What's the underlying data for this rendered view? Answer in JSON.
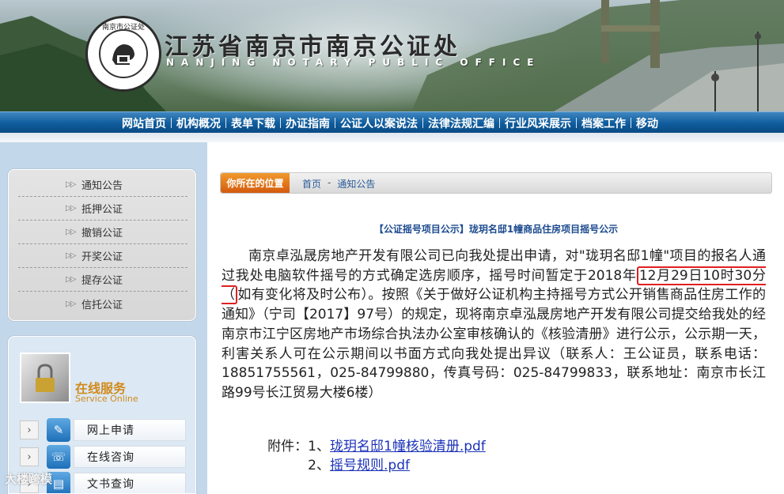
{
  "header": {
    "logo_text": "南京市公证处",
    "logo_ring_text": "NANJING NOTARY PUBLIC OFFICE",
    "title": "江苏省南京市南京公证处",
    "subtitle": "NANJING NOTARY PUBLIC OFFICE"
  },
  "nav": {
    "items": [
      "网站首页",
      "机构概况",
      "表单下载",
      "办证指南",
      "公证人以案说法",
      "法律法规汇编",
      "行业风采展示",
      "档案工作",
      "移动"
    ]
  },
  "sidebar": {
    "menu": [
      "通知公告",
      "抵押公证",
      "撤销公证",
      "开奖公证",
      "提存公证",
      "信托公证"
    ],
    "service": {
      "title": "在线服务",
      "subtitle": "Service Online",
      "items": [
        "网上申请",
        "在线咨询",
        "文书查询"
      ]
    }
  },
  "watermark": "大楼跨模",
  "breadcrumb": {
    "label": "你所在的位置",
    "home": "首页",
    "current": "通知公告"
  },
  "article": {
    "title": "【公证摇号项目公示】珑玥名邸1幢商品住房项目摇号公示",
    "body_before": "南京卓泓晟房地产开发有限公司已向我处提出申请，对\"珑玥名邸1幢\"项目的报名人通过我处电脑软件摇号的方式确定选房顺序，摇号时间暂定于2018年",
    "highlight": "12月29日10时30分（",
    "body_after": "如有变化将及时公布）。按照《关于做好公证机构主持摇号方式公开销售商品住房工作的通知》（宁司【2017】97号）的规定，现将南京卓泓晟房地产开发有限公司提交给我处的经南京市江宁区房地产市场综合执法办公室审核确认的《核验清册》进行公示，公示期一天，利害关系人可在公示期间以书面方式向我处提出异议（联系人：王公证员，联系电话：18851755561，025-84799880，传真号码：025-84799833，联系地址：南京市长江路99号长江贸易大楼6楼）",
    "attachments_prefix": "附件：",
    "attachments": [
      {
        "num": "1、",
        "name": "珑玥名邸1幢核验清册.pdf"
      },
      {
        "num": "2、",
        "name": "摇号规则.pdf"
      }
    ]
  },
  "colors": {
    "nav_blue": "#0f5c9c",
    "link_blue": "#1a32b8",
    "highlight_red": "#e02020",
    "crumb_orange": "#e0731a",
    "sidebar_blue": "#c3d7ea"
  }
}
